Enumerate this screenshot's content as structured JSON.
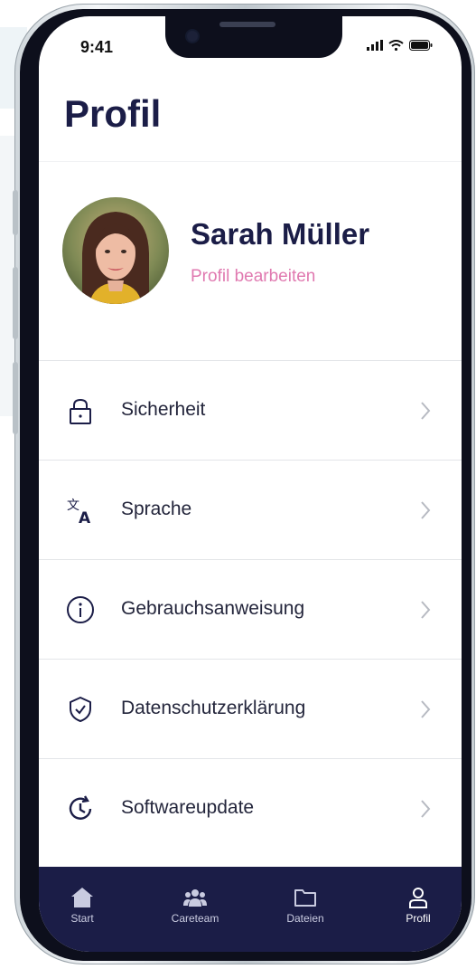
{
  "status_bar": {
    "time": "9:41"
  },
  "page": {
    "title": "Profil"
  },
  "profile": {
    "name": "Sarah Müller",
    "edit_label": "Profil bearbeiten"
  },
  "menu": {
    "items": [
      {
        "label": "Sicherheit",
        "icon": "lock-icon"
      },
      {
        "label": "Sprache",
        "icon": "translate-icon"
      },
      {
        "label": "Gebrauchsanweisung",
        "icon": "info-icon"
      },
      {
        "label": "Datenschutzerklärung",
        "icon": "shield-check-icon"
      },
      {
        "label": "Softwareupdate",
        "icon": "update-clock-icon"
      }
    ]
  },
  "tabbar": {
    "tabs": [
      {
        "label": "Start",
        "icon": "home-icon"
      },
      {
        "label": "Careteam",
        "icon": "team-icon"
      },
      {
        "label": "Dateien",
        "icon": "folder-icon"
      },
      {
        "label": "Profil",
        "icon": "person-icon",
        "active": true
      }
    ]
  },
  "colors": {
    "navy": "#1b1d47",
    "accent_pink": "#e079b0",
    "divider": "#e3e5e8"
  }
}
